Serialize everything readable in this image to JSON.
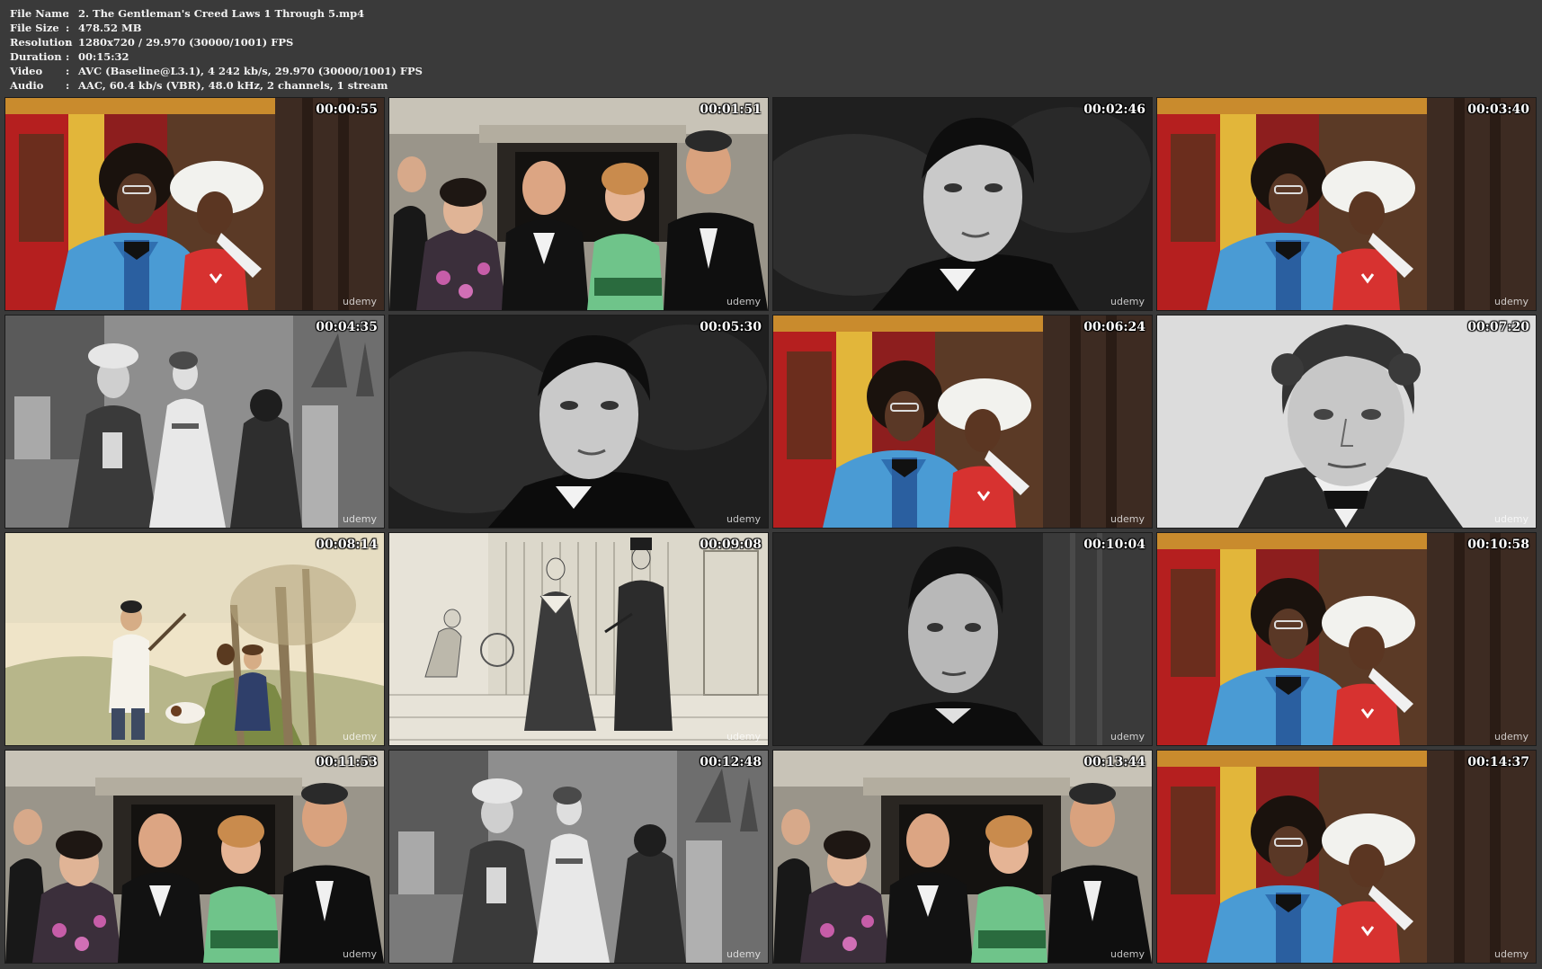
{
  "info": {
    "file_name": {
      "label": "File Name",
      "value": "2. The Gentleman's Creed Laws 1 Through 5.mp4"
    },
    "file_size": {
      "label": "File Size",
      "value": "478.52 MB"
    },
    "resolution": {
      "label": "Resolution",
      "value": "1280x720 / 29.970 (30000/1001) FPS"
    },
    "duration": {
      "label": "Duration",
      "value": "00:15:32"
    },
    "video": {
      "label": "Video",
      "value": "AVC (Baseline@L3.1), 4 242 kb/s, 29.970 (30000/1001) FPS"
    },
    "audio": {
      "label": "Audio",
      "value": "AAC, 60.4 kb/s (VBR), 48.0 kHz, 2 channels, 1 stream"
    }
  },
  "separator": ":",
  "watermark": "udemy",
  "thumbnails": [
    {
      "time": "00:00:55",
      "scene": "couple-color"
    },
    {
      "time": "00:01:51",
      "scene": "group-photo"
    },
    {
      "time": "00:02:46",
      "scene": "bw-portrait-man"
    },
    {
      "time": "00:03:40",
      "scene": "couple-color"
    },
    {
      "time": "00:04:35",
      "scene": "engraving-figures"
    },
    {
      "time": "00:05:30",
      "scene": "bw-portrait-man"
    },
    {
      "time": "00:06:24",
      "scene": "couple-color"
    },
    {
      "time": "00:07:20",
      "scene": "engraving-portrait"
    },
    {
      "time": "00:08:14",
      "scene": "watercolor-hunter"
    },
    {
      "time": "00:09:08",
      "scene": "sketch-street"
    },
    {
      "time": "00:10:04",
      "scene": "bw-portrait-young"
    },
    {
      "time": "00:10:58",
      "scene": "couple-color"
    },
    {
      "time": "00:11:53",
      "scene": "group-photo"
    },
    {
      "time": "00:12:48",
      "scene": "engraving-figures"
    },
    {
      "time": "00:13:44",
      "scene": "group-photo"
    },
    {
      "time": "00:14:37",
      "scene": "couple-color"
    }
  ]
}
